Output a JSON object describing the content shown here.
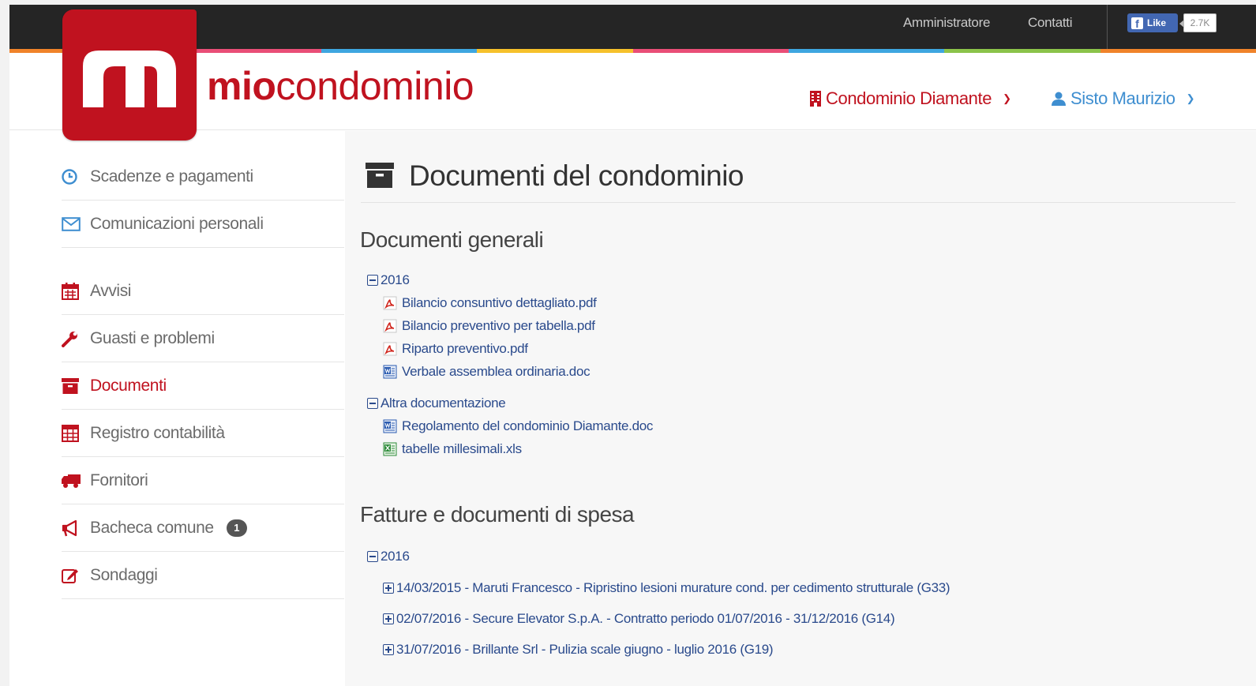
{
  "topbar": {
    "links": [
      "Amministratore",
      "Contatti"
    ],
    "fb_like_label": "Like",
    "fb_count": "2.7K"
  },
  "colors": {
    "brand_red": "#c0121f",
    "topbar_bg": "#252525",
    "link_blue": "#2a4a8c",
    "user_blue": "#3e8ed0",
    "strip": [
      "#f0832a",
      "#e94e77",
      "#3ea6e0",
      "#f6c12b",
      "#e94e77",
      "#3ea6e0",
      "#8bc34a",
      "#f0832a"
    ]
  },
  "header": {
    "brand_bold": "mio",
    "brand_light": "condominio",
    "condo_menu": "Condominio Diamante",
    "user_menu": "Sisto Maurizio"
  },
  "sidebar": {
    "items": [
      {
        "label": "Scadenze e pagamenti",
        "icon": "clock-icon"
      },
      {
        "label": "Comunicazioni personali",
        "icon": "envelope-icon"
      },
      {
        "label": "Avvisi",
        "icon": "calendar-icon"
      },
      {
        "label": "Guasti e problemi",
        "icon": "wrench-icon"
      },
      {
        "label": "Documenti",
        "icon": "archive-icon",
        "active": true
      },
      {
        "label": "Registro contabilità",
        "icon": "table-icon"
      },
      {
        "label": "Fornitori",
        "icon": "truck-icon"
      },
      {
        "label": "Bacheca comune",
        "icon": "megaphone-icon",
        "badge": "1"
      },
      {
        "label": "Sondaggi",
        "icon": "edit-icon"
      }
    ]
  },
  "main": {
    "title": "Documenti del condominio",
    "general": {
      "title": "Documenti generali",
      "folders": [
        {
          "label": "2016",
          "files": [
            {
              "name": "Bilancio consuntivo dettagliato.pdf",
              "type": "pdf"
            },
            {
              "name": "Bilancio preventivo per tabella.pdf",
              "type": "pdf"
            },
            {
              "name": "Riparto preventivo.pdf",
              "type": "pdf"
            },
            {
              "name": "Verbale assemblea ordinaria.doc",
              "type": "doc"
            }
          ]
        },
        {
          "label": "Altra documentazione",
          "files": [
            {
              "name": "Regolamento del condominio Diamante.doc",
              "type": "doc"
            },
            {
              "name": "tabelle millesimali.xls",
              "type": "xls"
            }
          ]
        }
      ]
    },
    "invoices": {
      "title": "Fatture e documenti di spesa",
      "folder": "2016",
      "items": [
        "14/03/2015 - Maruti Francesco - Ripristino lesioni murature cond. per cedimento strutturale (G33)",
        "02/07/2016 - Secure Elevator S.p.A. - Contratto periodo 01/07/2016 - 31/12/2016 (G14)",
        "31/07/2016 - Brillante Srl - Pulizia scale giugno - luglio 2016 (G19)"
      ]
    }
  }
}
